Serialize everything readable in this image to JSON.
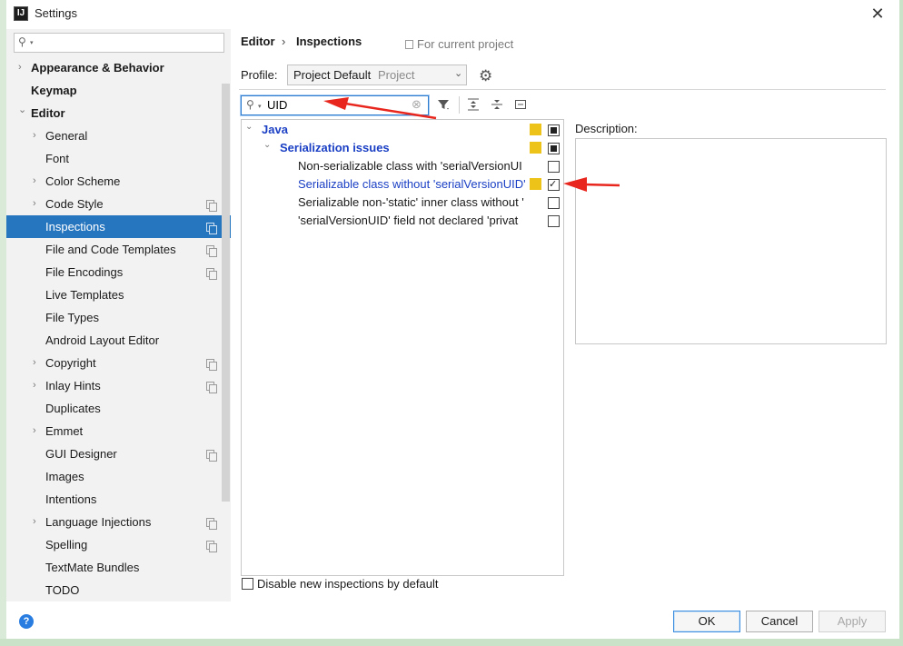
{
  "window": {
    "title": "Settings",
    "app_icon": "IJ"
  },
  "sidebar": {
    "search_placeholder": "",
    "items": [
      {
        "label": "Appearance & Behavior",
        "arrow": true,
        "level": 0,
        "bold": true,
        "copy": false
      },
      {
        "label": "Keymap",
        "arrow": false,
        "level": 0,
        "bold": true,
        "copy": false
      },
      {
        "label": "Editor",
        "arrow": "open",
        "level": 0,
        "bold": true,
        "copy": false
      },
      {
        "label": "General",
        "arrow": true,
        "level": 1,
        "copy": false
      },
      {
        "label": "Font",
        "arrow": false,
        "level": 1,
        "copy": false
      },
      {
        "label": "Color Scheme",
        "arrow": true,
        "level": 1,
        "copy": false
      },
      {
        "label": "Code Style",
        "arrow": true,
        "level": 1,
        "copy": true
      },
      {
        "label": "Inspections",
        "arrow": false,
        "level": 1,
        "copy": true,
        "selected": true
      },
      {
        "label": "File and Code Templates",
        "arrow": false,
        "level": 1,
        "copy": true
      },
      {
        "label": "File Encodings",
        "arrow": false,
        "level": 1,
        "copy": true
      },
      {
        "label": "Live Templates",
        "arrow": false,
        "level": 1,
        "copy": false
      },
      {
        "label": "File Types",
        "arrow": false,
        "level": 1,
        "copy": false
      },
      {
        "label": "Android Layout Editor",
        "arrow": false,
        "level": 1,
        "copy": false
      },
      {
        "label": "Copyright",
        "arrow": true,
        "level": 1,
        "copy": true
      },
      {
        "label": "Inlay Hints",
        "arrow": true,
        "level": 1,
        "copy": true
      },
      {
        "label": "Duplicates",
        "arrow": false,
        "level": 1,
        "copy": false
      },
      {
        "label": "Emmet",
        "arrow": true,
        "level": 1,
        "copy": false
      },
      {
        "label": "GUI Designer",
        "arrow": false,
        "level": 1,
        "copy": true
      },
      {
        "label": "Images",
        "arrow": false,
        "level": 1,
        "copy": false
      },
      {
        "label": "Intentions",
        "arrow": false,
        "level": 1,
        "copy": false
      },
      {
        "label": "Language Injections",
        "arrow": true,
        "level": 1,
        "copy": true
      },
      {
        "label": "Spelling",
        "arrow": false,
        "level": 1,
        "copy": true
      },
      {
        "label": "TextMate Bundles",
        "arrow": false,
        "level": 1,
        "copy": false
      },
      {
        "label": "TODO",
        "arrow": false,
        "level": 1,
        "copy": false
      }
    ]
  },
  "breadcrumb": {
    "parent": "Editor",
    "separator": "›",
    "current": "Inspections",
    "scope": "For current project"
  },
  "profile": {
    "label": "Profile:",
    "value": "Project Default",
    "scope": "Project"
  },
  "filter": {
    "value": "UID"
  },
  "tree": {
    "rows": [
      {
        "label": "Java",
        "style": "blue-bold",
        "arrow": "open",
        "indent": 0,
        "severity": true,
        "checkbox": "partial"
      },
      {
        "label": "Serialization issues",
        "style": "blue-bold",
        "arrow": "open",
        "indent": 1,
        "severity": true,
        "checkbox": "partial"
      },
      {
        "label": "Non-serializable class with 'serialVersionUI",
        "style": "normal",
        "arrow": false,
        "indent": 2,
        "severity": false,
        "checkbox": "unchecked"
      },
      {
        "label": "Serializable class without 'serialVersionUID'",
        "style": "blue",
        "arrow": false,
        "indent": 2,
        "severity": true,
        "checkbox": "checked"
      },
      {
        "label": "Serializable non-'static' inner class without '",
        "style": "normal",
        "arrow": false,
        "indent": 2,
        "severity": false,
        "checkbox": "unchecked"
      },
      {
        "label": "'serialVersionUID' field not declared 'privat",
        "style": "normal",
        "arrow": false,
        "indent": 2,
        "severity": false,
        "checkbox": "unchecked"
      }
    ]
  },
  "description": {
    "label": "Description:"
  },
  "disable_new": {
    "label": "Disable new inspections by default",
    "checked": false
  },
  "buttons": {
    "ok": "OK",
    "cancel": "Cancel",
    "apply": "Apply"
  },
  "colors": {
    "accent": "#2675bf",
    "severity": "#edc31a",
    "link": "#1a3fc4",
    "annotation": "#e8261d"
  }
}
